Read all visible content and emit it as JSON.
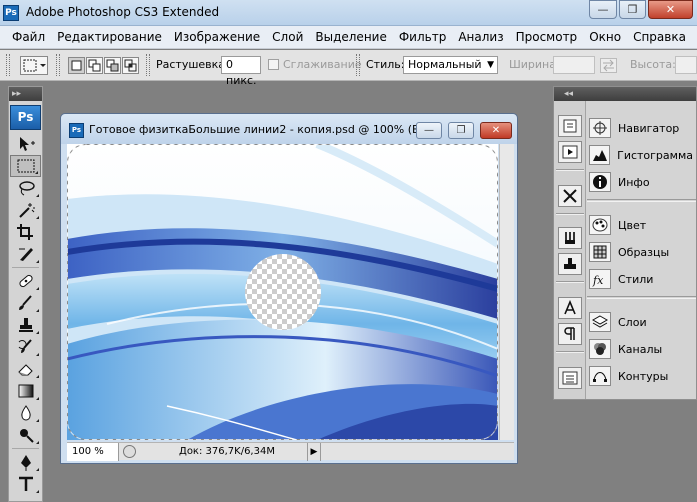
{
  "window": {
    "title": "Adobe Photoshop CS3 Extended",
    "app_icon": "Ps",
    "minimize": "—",
    "restore": "❐",
    "close": "✕"
  },
  "menu": [
    "Файл",
    "Редактирование",
    "Изображение",
    "Слой",
    "Выделение",
    "Фильтр",
    "Анализ",
    "Просмотр",
    "Окно",
    "Справка"
  ],
  "options_bar": {
    "feather_label": "Растушевка:",
    "feather_value": "0 пикс.",
    "antialias_label": "Сглаживание",
    "style_label": "Стиль:",
    "style_value": "Нормальный",
    "width_label": "Ширина:",
    "height_label": "Высота:"
  },
  "toolbox": {
    "logo": "Ps",
    "collapse": "▸▸"
  },
  "document": {
    "title": "Готовое физиткаБольшие линии2 - копия.psd @ 100% (Б...",
    "icon": "Ps",
    "zoom": "100 %",
    "doc_info": "Док: 376,7K/6,34M",
    "minimize": "—",
    "restore": "❐",
    "close": "✕",
    "status_arrow": "▶"
  },
  "dock": {
    "collapse": "◂◂",
    "groups": [
      [
        "Навигатор",
        "Гистограмма",
        "Инфо"
      ],
      [
        "Цвет",
        "Образцы",
        "Стили"
      ],
      [
        "Слои",
        "Каналы",
        "Контуры"
      ]
    ]
  },
  "colors": {
    "accent": "#1b5ea8",
    "wave_dark": "#2a4aa8",
    "wave_light": "#9fd0f2"
  }
}
